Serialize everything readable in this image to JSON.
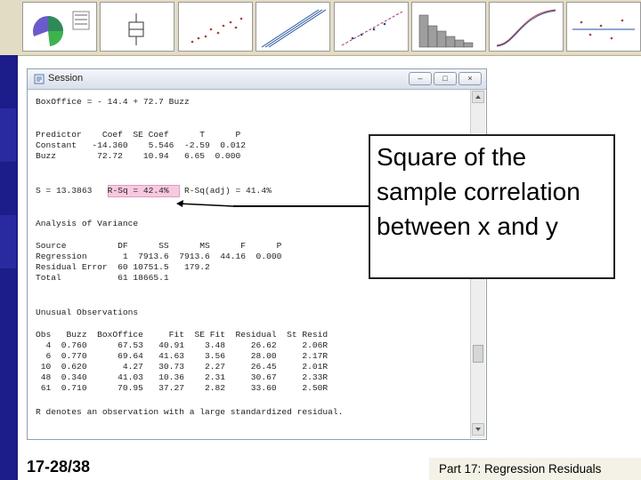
{
  "slide": {
    "page_number": "17-28/38",
    "footer_title": "Part 17: Regression Residuals",
    "callout_text": "Square of the sample correlation between x and y"
  },
  "thumbnails": [
    "pie-chart",
    "box-plot",
    "scatter-plot",
    "probability-plot",
    "fitted-line-plot",
    "histogram",
    "cumulative-plot",
    "residual-plot"
  ],
  "window": {
    "title": "Session",
    "controls": {
      "minimize": "–",
      "maximize": "□",
      "close": "×"
    }
  },
  "output_lines": [
    "BoxOffice = - 14.4 + 72.7 Buzz",
    "",
    "Predictor    Coef  SE Coef      T      P",
    "Constant   -14.360    5.546  -2.59  0.012",
    "Buzz        72.72    10.94   6.65  0.000",
    "",
    "",
    "S = 13.3863   R-Sq = 42.4%   R-Sq(adj) = 41.4%",
    "",
    "Analysis of Variance",
    "",
    "Source          DF      SS      MS      F      P",
    "Regression       1  7913.6  7913.6  44.16  0.000",
    "Residual Error  60 10751.5   179.2",
    "Total           61 18665.1",
    "",
    "",
    "Unusual Observations",
    "",
    "Obs   Buzz  BoxOffice     Fit  SE Fit  Residual  St Resid",
    "  4  0.760      67.53   40.91    3.48     26.62     2.06R",
    "  6  0.770      69.64   41.63    3.56     28.00     2.17R",
    " 10  0.620       4.27   30.73    2.27     26.45     2.01R",
    " 48  0.340      41.03   10.36    2.31     30.67     2.33R",
    " 61  0.710      70.95   37.27    2.82     33.60     2.50R",
    "",
    "R denotes an observation with a large standardized residual."
  ]
}
